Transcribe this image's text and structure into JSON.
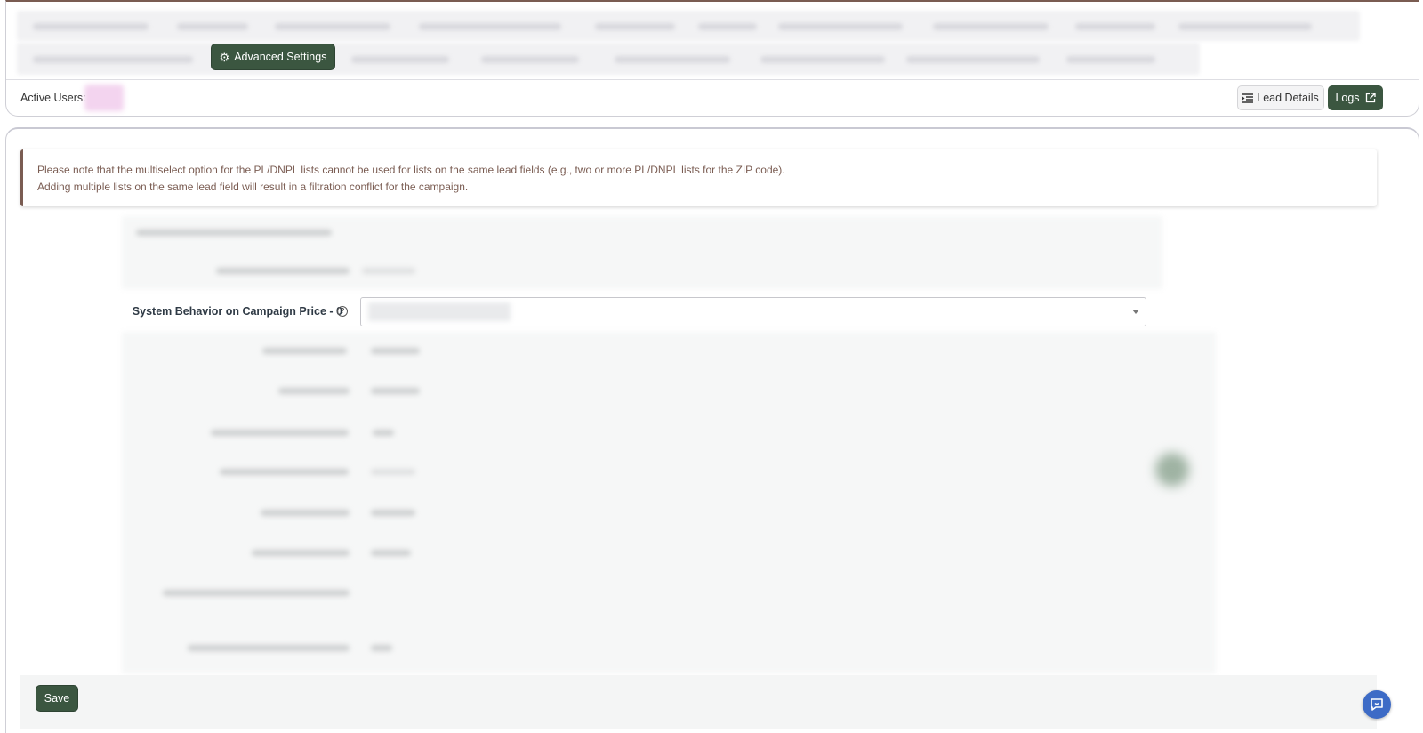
{
  "header": {
    "advanced_settings_label": "Advanced Settings",
    "active_users_label": "Active Users:",
    "lead_details_label": "Lead Details",
    "logs_label": "Logs"
  },
  "notice": {
    "line1": "Please note that the multiselect option for the PL/DNPL lists cannot be used for lists on the same lead fields (e.g., two or more PL/DNPL lists for the ZIP code).",
    "line2": "Adding multiple lists on the same lead field will result in a filtration conflict for the campaign."
  },
  "form": {
    "system_behavior_label": "System Behavior on Campaign Price - 0",
    "help_symbol": "?"
  },
  "footer": {
    "save_label": "Save"
  },
  "colors": {
    "primary_green": "#3b5640",
    "accent_brown": "#7a5c52",
    "chat_blue": "#3d6bc6"
  },
  "icons": {
    "advanced_settings": "gear-icon",
    "lead_details": "list-indent-icon",
    "logs": "external-link-icon",
    "help": "question-circle-icon",
    "chat": "chat-bubble-icon"
  }
}
